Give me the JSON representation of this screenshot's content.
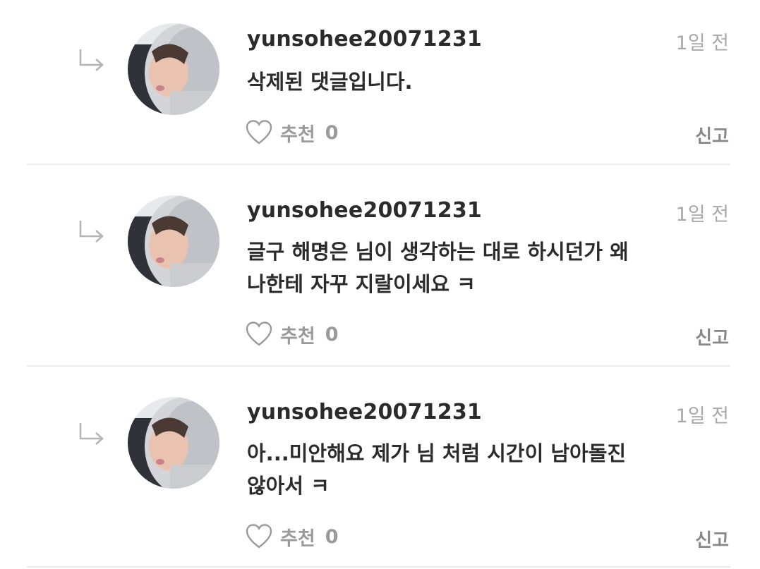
{
  "comments": [
    {
      "username": "yunsohee20071231",
      "time": "1일 전",
      "lines": [
        "삭제된 댓글입니다."
      ],
      "like_label": "추천",
      "like_count": "0",
      "report_label": "신고"
    },
    {
      "username": "yunsohee20071231",
      "time": "1일 전",
      "lines": [
        "글구 해명은 님이 생각하는 대로 하시던가 왜",
        "나한테 자꾸 지랄이세요 ㅋ"
      ],
      "like_label": "추천",
      "like_count": "0",
      "report_label": "신고"
    },
    {
      "username": "yunsohee20071231",
      "time": "1일 전",
      "lines": [
        "아...미안해요 제가 님 처럼 시간이 남아돌진",
        "않아서 ㅋ"
      ],
      "like_label": "추천",
      "like_count": "0",
      "report_label": "신고"
    }
  ],
  "icons": {
    "reply": "reply-arrow-icon",
    "like": "heart-icon",
    "avatar": "avatar-photo"
  },
  "colors": {
    "text": "#2b2b2b",
    "muted": "#a8a8a8",
    "divider": "#ececec",
    "icon": "#b5b5b5"
  }
}
